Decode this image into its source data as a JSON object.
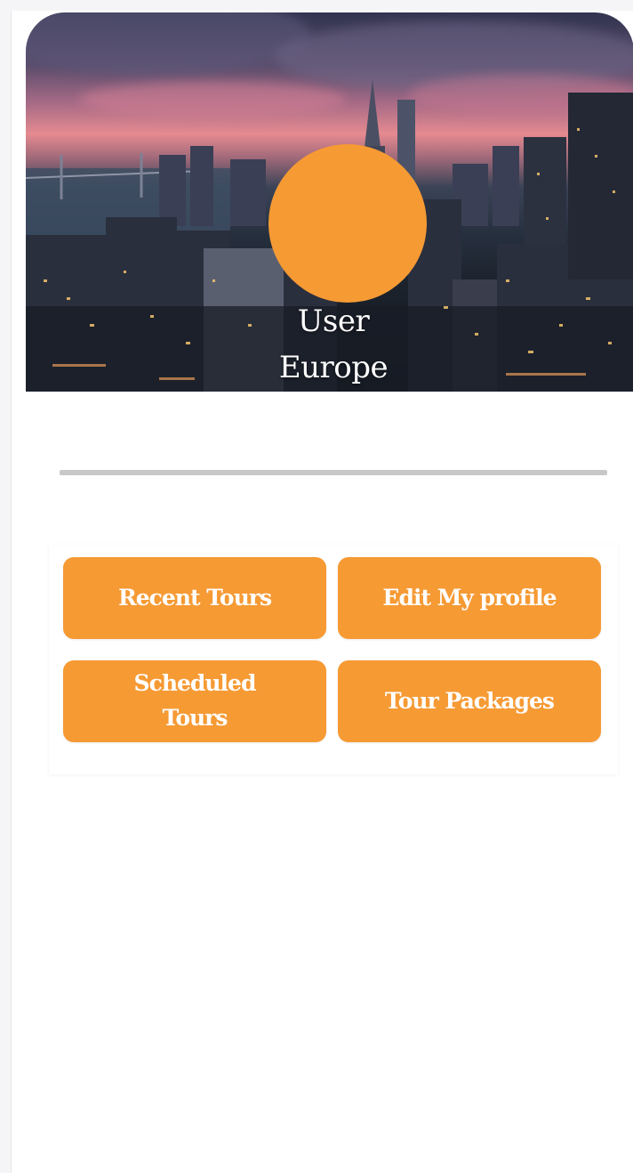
{
  "profile": {
    "name": "User",
    "region": "Europe"
  },
  "actions": [
    {
      "label": "Recent Tours"
    },
    {
      "label": "Edit My profile"
    },
    {
      "label": "Scheduled Tours"
    },
    {
      "label": "Tour Packages"
    }
  ],
  "colors": {
    "accent": "#f69a34",
    "divider": "#c8c8c8",
    "background": "#ffffff"
  },
  "icons": {
    "hero": "city-skyline-photo"
  }
}
